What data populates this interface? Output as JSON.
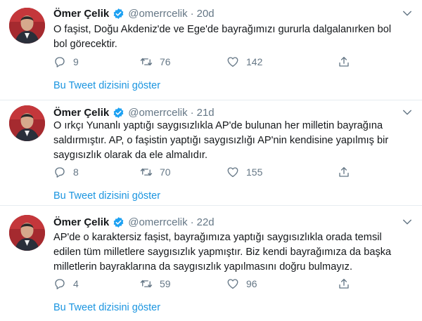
{
  "tweets": [
    {
      "name": "Ömer Çelik",
      "handle": "@omerrcelik",
      "separator": "·",
      "time": "20d",
      "text_lines": [
        "O faşist, Doğu Akdeniz'de ve Ege'de bayrağımızı gururla dalgalanırken bol",
        "bol görecektir."
      ],
      "replies": "9",
      "retweets": "76",
      "likes": "142",
      "thread_link": "Bu Tweet dizisini göster"
    },
    {
      "name": "Ömer Çelik",
      "handle": "@omerrcelik",
      "separator": "·",
      "time": "21d",
      "text_lines": [
        "O ırkçı Yunanlı yaptığı saygısızlıkla AP'de bulunan her milletin bayrağına",
        "saldırmıştır. AP, o faşistin yaptığı saygısızlığı AP'nin kendisine yapılmış bir",
        "saygısızlık olarak da ele almalıdır."
      ],
      "replies": "8",
      "retweets": "70",
      "likes": "155",
      "thread_link": "Bu Tweet dizisini göster"
    },
    {
      "name": "Ömer Çelik",
      "handle": "@omerrcelik",
      "separator": "·",
      "time": "22d",
      "text_lines": [
        "AP'de o karaktersiz faşist, bayrağımıza yaptığı saygısızlıkla orada temsil",
        "edilen tüm milletlere saygısızlık yapmıştır. Biz kendi bayrağımıza da başka",
        "milletlerin bayraklarına da saygısızlık yapılmasını doğru bulmayız."
      ],
      "replies": "4",
      "retweets": "59",
      "likes": "96",
      "thread_link": "Bu Tweet dizisini göster"
    }
  ],
  "colors": {
    "link": "#1b95e0",
    "muted": "#657786",
    "text": "#14171a",
    "divider": "#e6ecf0",
    "verified": "#1da1f2"
  },
  "icons": [
    "verified-badge-icon",
    "chevron-down-icon",
    "reply-icon",
    "retweet-icon",
    "like-icon",
    "share-icon"
  ]
}
